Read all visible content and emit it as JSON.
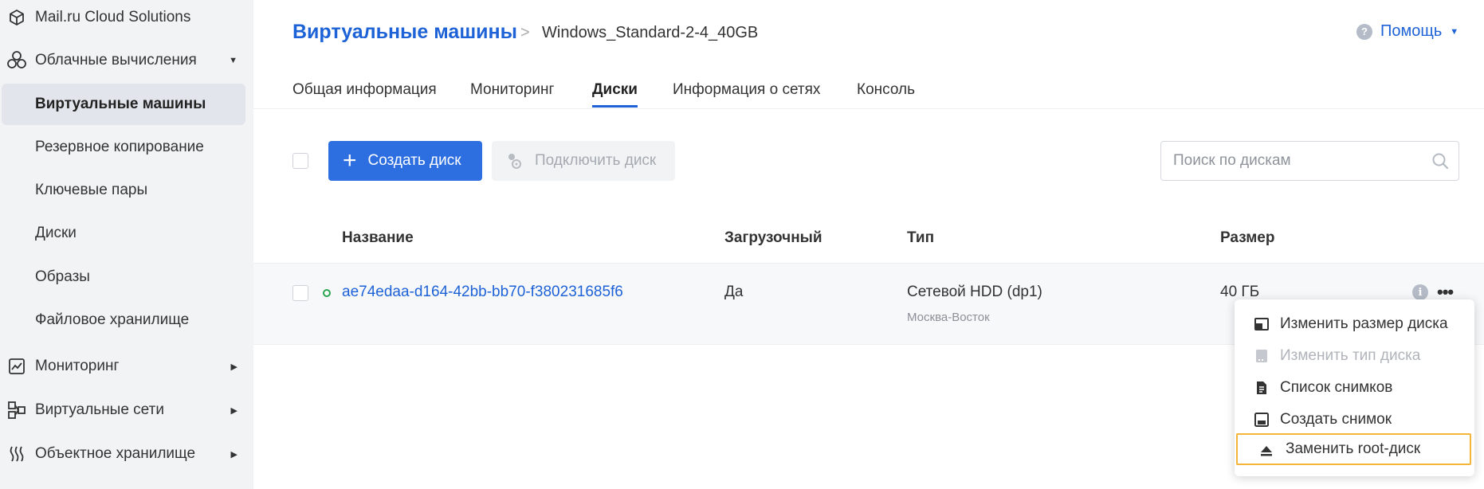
{
  "sidebar": {
    "brand": "Mail.ru Cloud Solutions",
    "compute": "Облачные вычисления",
    "items": [
      {
        "label": "Виртуальные машины"
      },
      {
        "label": "Резервное копирование"
      },
      {
        "label": "Ключевые пары"
      },
      {
        "label": "Диски"
      },
      {
        "label": "Образы"
      },
      {
        "label": "Файловое хранилище"
      }
    ],
    "monitoring": "Мониторинг",
    "networks": "Виртуальные сети",
    "object_storage": "Объектное хранилище"
  },
  "header": {
    "title": "Виртуальные машины",
    "separator": ">",
    "vm_name": "Windows_Standard-2-4_40GB",
    "help": "Помощь"
  },
  "tabs": [
    {
      "label": "Общая информация"
    },
    {
      "label": "Мониторинг"
    },
    {
      "label": "Диски"
    },
    {
      "label": "Информация о сетях"
    },
    {
      "label": "Консоль"
    }
  ],
  "toolbar": {
    "create_disk": "Создать диск",
    "attach_disk": "Подключить диск",
    "search_placeholder": "Поиск по дискам"
  },
  "table": {
    "columns": [
      "Название",
      "Загрузочный",
      "Тип",
      "Размер"
    ],
    "rows": [
      {
        "name": "ae74edaa-d164-42bb-bb70-f380231685f6",
        "bootable": "Да",
        "type": "Сетевой HDD (dp1)",
        "zone": "Москва-Восток",
        "size": "40 ГБ"
      }
    ]
  },
  "context_menu": {
    "items": [
      {
        "label": "Изменить размер диска",
        "icon": "resize-icon"
      },
      {
        "label": "Изменить тип диска",
        "icon": "disk-type-icon"
      },
      {
        "label": "Список снимков",
        "icon": "document-icon"
      },
      {
        "label": "Создать снимок",
        "icon": "save-icon"
      },
      {
        "label": "Заменить root-диск",
        "icon": "eject-icon"
      }
    ]
  },
  "colors": {
    "accent": "#1d62d6",
    "primary_button": "#2d6fe0",
    "highlight_border": "#f5b43a",
    "status_ok": "#2aa44f"
  }
}
